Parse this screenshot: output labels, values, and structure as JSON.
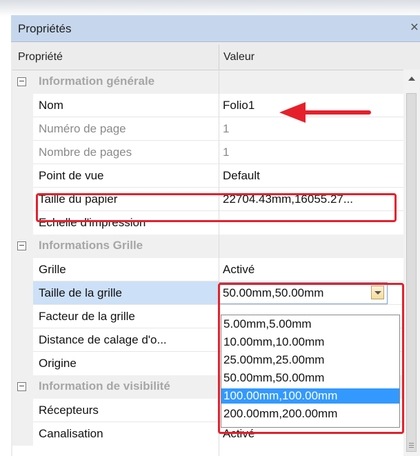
{
  "panel": {
    "title": "Propriétés",
    "close": "×"
  },
  "grid_header": {
    "property": "Propriété",
    "value": "Valeur"
  },
  "categories": {
    "general": {
      "label": "Information générale",
      "toggle": "−"
    },
    "grid": {
      "label": "Informations Grille",
      "toggle": "−"
    },
    "visibility": {
      "label": "Information de visibilité",
      "toggle": "−"
    }
  },
  "rows": {
    "nom": {
      "name": "Nom",
      "value": "Folio1"
    },
    "numero": {
      "name": "Numéro de page",
      "value": "1"
    },
    "nombre": {
      "name": "Nombre de pages",
      "value": "1"
    },
    "point": {
      "name": "Point de vue",
      "value": "Default"
    },
    "taille_papier": {
      "name": "Taille du papier",
      "value": "22704.43mm,16055.27..."
    },
    "echelle": {
      "name": "Echelle d'impression",
      "value": ""
    },
    "grille": {
      "name": "Grille",
      "value": "Activé"
    },
    "taille_grille": {
      "name": "Taille de la grille",
      "value": "50.00mm,50.00mm"
    },
    "facteur": {
      "name": "Facteur de la grille",
      "value": ""
    },
    "distance": {
      "name": "Distance de calage d'o...",
      "value": ""
    },
    "origine": {
      "name": "Origine",
      "value": ""
    },
    "recepteurs": {
      "name": "Récepteurs",
      "value": ""
    },
    "canalisation": {
      "name": "Canalisation",
      "value": "Activé"
    }
  },
  "dropdown": {
    "options": [
      "5.00mm,5.00mm",
      "10.00mm,10.00mm",
      "25.00mm,25.00mm",
      "50.00mm,50.00mm",
      "100.00mm,100.00mm",
      "200.00mm,200.00mm"
    ],
    "highlighted_index": 4
  },
  "colors": {
    "highlight": "#3399ff",
    "annotation": "#e5202b",
    "selected_row": "#cce0f7"
  }
}
